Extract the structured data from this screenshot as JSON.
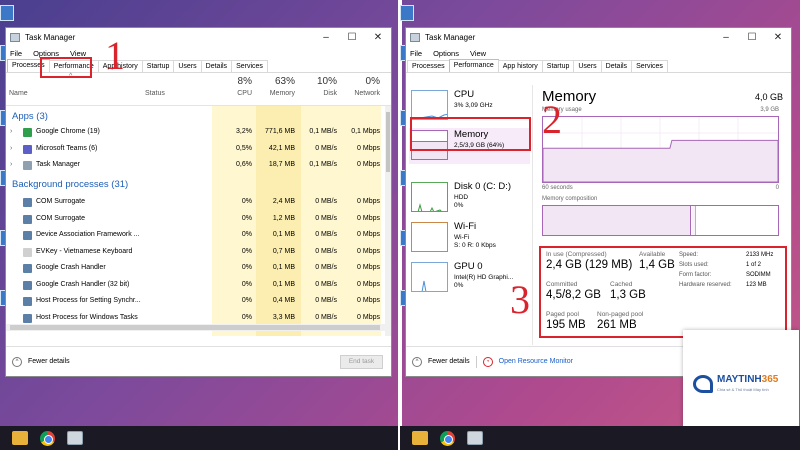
{
  "left": {
    "title": "Task Manager",
    "menu": [
      "File",
      "Options",
      "View"
    ],
    "tabs": [
      "Processes",
      "Performance",
      "App history",
      "Startup",
      "Users",
      "Details",
      "Services"
    ],
    "callout": "1",
    "header": {
      "name": "Name",
      "status": "Status",
      "cpu_pct": "8%",
      "cpu": "CPU",
      "mem_pct": "63%",
      "mem": "Memory",
      "disk_pct": "10%",
      "disk": "Disk",
      "net_pct": "0%",
      "net": "Network"
    },
    "apps_group": "Apps (3)",
    "apps": [
      {
        "name": "Google Chrome (19)",
        "cpu": "3,2%",
        "mem": "771,6 MB",
        "disk": "0,1 MB/s",
        "net": "0,1 Mbps",
        "color": "#2f9f4d"
      },
      {
        "name": "Microsoft Teams (6)",
        "cpu": "0,5%",
        "mem": "42,1 MB",
        "disk": "0 MB/s",
        "net": "0 Mbps",
        "color": "#5b5fc7"
      },
      {
        "name": "Task Manager",
        "cpu": "0,6%",
        "mem": "18,7 MB",
        "disk": "0,1 MB/s",
        "net": "0 Mbps",
        "color": "#8fa0b0"
      }
    ],
    "bg_group": "Background processes (31)",
    "background": [
      {
        "name": "COM Surrogate",
        "cpu": "0%",
        "mem": "2,4 MB",
        "disk": "0 MB/s",
        "net": "0 Mbps",
        "color": "#5c7fa8"
      },
      {
        "name": "COM Surrogate",
        "cpu": "0%",
        "mem": "1,2 MB",
        "disk": "0 MB/s",
        "net": "0 Mbps",
        "color": "#5c7fa8"
      },
      {
        "name": "Device Association Framework ...",
        "cpu": "0%",
        "mem": "0,1 MB",
        "disk": "0 MB/s",
        "net": "0 Mbps",
        "color": "#5c7fa8"
      },
      {
        "name": "EVKey - Vietnamese Keyboard",
        "cpu": "0%",
        "mem": "0,7 MB",
        "disk": "0 MB/s",
        "net": "0 Mbps",
        "color": "#d0d0d0"
      },
      {
        "name": "Google Crash Handler",
        "cpu": "0%",
        "mem": "0,1 MB",
        "disk": "0 MB/s",
        "net": "0 Mbps",
        "color": "#5c7fa8"
      },
      {
        "name": "Google Crash Handler (32 bit)",
        "cpu": "0%",
        "mem": "0,1 MB",
        "disk": "0 MB/s",
        "net": "0 Mbps",
        "color": "#5c7fa8"
      },
      {
        "name": "Host Process for Setting Synchr...",
        "cpu": "0%",
        "mem": "0,4 MB",
        "disk": "0 MB/s",
        "net": "0 Mbps",
        "color": "#5c7fa8"
      },
      {
        "name": "Host Process for Windows Tasks",
        "cpu": "0%",
        "mem": "3,3 MB",
        "disk": "0 MB/s",
        "net": "0 Mbps",
        "color": "#5c7fa8"
      }
    ],
    "fewer_details": "Fewer details",
    "end_task": "End task"
  },
  "right": {
    "title": "Task Manager",
    "menu": [
      "File",
      "Options",
      "View"
    ],
    "tabs": [
      "Processes",
      "Performance",
      "App history",
      "Startup",
      "Users",
      "Details",
      "Services"
    ],
    "callout2": "2",
    "callout3": "3",
    "resources": [
      {
        "title": "CPU",
        "sub1": "3%  3,09 GHz",
        "sub2": ""
      },
      {
        "title": "Memory",
        "sub1": "2,5/3,9 GB (64%)",
        "sub2": ""
      },
      {
        "title": "Disk 0 (C: D:)",
        "sub1": "HDD",
        "sub2": "0%"
      },
      {
        "title": "Wi-Fi",
        "sub1": "Wi-Fi",
        "sub2": "S: 0  R: 0 Kbps"
      },
      {
        "title": "GPU 0",
        "sub1": "Intel(R) HD Graphi...",
        "sub2": "0%"
      }
    ],
    "memory": {
      "title": "Memory",
      "total": "4,0 GB",
      "usage_label": "Memory usage",
      "usage_max": "3,9 GB",
      "seconds": "60 seconds",
      "zero": "0",
      "composition": "Memory composition",
      "usage_level": 0.64,
      "stats": {
        "in_use_label": "In use (Compressed)",
        "in_use": "2,4 GB (129 MB)",
        "available_label": "Available",
        "available": "1,4 GB",
        "committed_label": "Committed",
        "committed": "4,5/8,2 GB",
        "cached_label": "Cached",
        "cached": "1,3 GB",
        "paged_label": "Paged pool",
        "paged": "195 MB",
        "nonpaged_label": "Non-paged pool",
        "nonpaged": "261 MB"
      },
      "specs": [
        {
          "k": "Speed:",
          "v": "2133 MHz"
        },
        {
          "k": "Slots used:",
          "v": "1 of 2"
        },
        {
          "k": "Form factor:",
          "v": "SODIMM"
        },
        {
          "k": "Hardware reserved:",
          "v": "123 MB"
        }
      ]
    },
    "fewer_details": "Fewer details",
    "open_monitor": "Open Resource Monitor"
  },
  "logo": {
    "brand_a": "MAYTINH",
    "brand_b": "365",
    "tagline": "Chia sẻ & Thủ thuật Máy tính"
  },
  "colors": {
    "accent_red": "#d9232d",
    "memory_purple": "#a766b7",
    "group_blue": "#1c5fb8",
    "cpu_shade": "#fff7cf",
    "memory_shade": "#fbeeb0"
  }
}
